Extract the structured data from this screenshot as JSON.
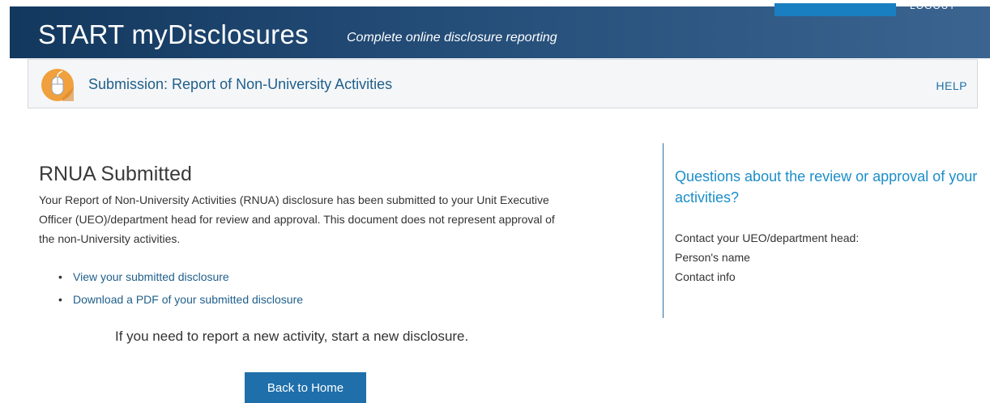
{
  "header": {
    "app_title": "START myDisclosures",
    "tagline": "Complete online disclosure reporting",
    "logout_label": "LOGOUT"
  },
  "subheader": {
    "icon": "computer-mouse-icon",
    "title": "Submission: Report of Non-University Activities",
    "help_label": "HELP"
  },
  "main": {
    "heading": "RNUA Submitted",
    "intro": "Your Report of Non-University Activities (RNUA) disclosure has been submitted to your Unit Executive Officer (UEO)/department head for review and approval. This document does not represent approval of the non-University activities.",
    "links": [
      {
        "label": "View your submitted disclosure"
      },
      {
        "label": "Download a PDF of your submitted disclosure"
      }
    ],
    "new_activity_text": "If you need to report a new activity, start a new disclosure.",
    "back_button_label": "Back to Home"
  },
  "sidebar": {
    "heading": "Questions about the review or approval of your activities?",
    "contact_label": "Contact your UEO/department head:",
    "person_name": "Person's name",
    "contact_info": "Contact info"
  },
  "colors": {
    "header_dark": "#13385e",
    "header_light": "#3b6590",
    "link": "#1f5f8b",
    "accent": "#1b8ec9",
    "button": "#1f6fab",
    "icon_orange": "#f0a03c"
  }
}
